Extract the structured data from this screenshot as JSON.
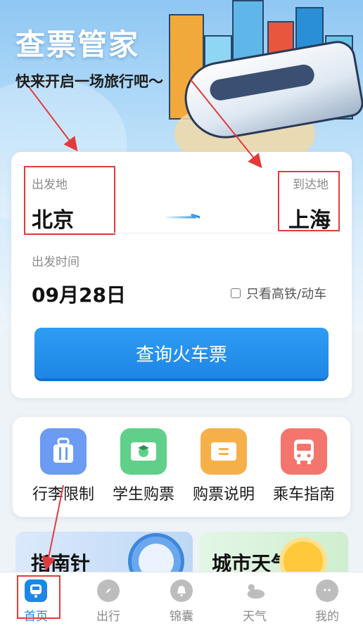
{
  "header": {
    "title": "查票管家",
    "slogan": "快来开启一场旅行吧～"
  },
  "search": {
    "from_label": "出发地",
    "from_city": "北京",
    "to_label": "到达地",
    "to_city": "上海",
    "date_label": "出发时间",
    "date_value": "09月28日",
    "checkbox_label": "只看高铁/动车",
    "checkbox_checked": false,
    "query_button": "查询火车票"
  },
  "quick_menu": {
    "items": [
      {
        "label": "行李限制",
        "icon": "luggage-icon",
        "color": "#6c9bf4"
      },
      {
        "label": "学生购票",
        "icon": "student-ticket-icon",
        "color": "#5fcf8a"
      },
      {
        "label": "购票说明",
        "icon": "ticket-info-icon",
        "color": "#f6b04a"
      },
      {
        "label": "乘车指南",
        "icon": "bus-icon",
        "color": "#f4756e"
      }
    ]
  },
  "features": {
    "left_title": "指南针",
    "right_title": "城市天气"
  },
  "bottom_nav": {
    "items": [
      {
        "label": "首页",
        "icon": "home-train-icon",
        "active": true
      },
      {
        "label": "出行",
        "icon": "compass-icon",
        "active": false
      },
      {
        "label": "锦囊",
        "icon": "bell-icon",
        "active": false
      },
      {
        "label": "天气",
        "icon": "weather-icon",
        "active": false
      },
      {
        "label": "我的",
        "icon": "profile-icon",
        "active": false
      }
    ]
  },
  "colors": {
    "accent": "#1e86e6",
    "annotation": "#e23b3b"
  }
}
